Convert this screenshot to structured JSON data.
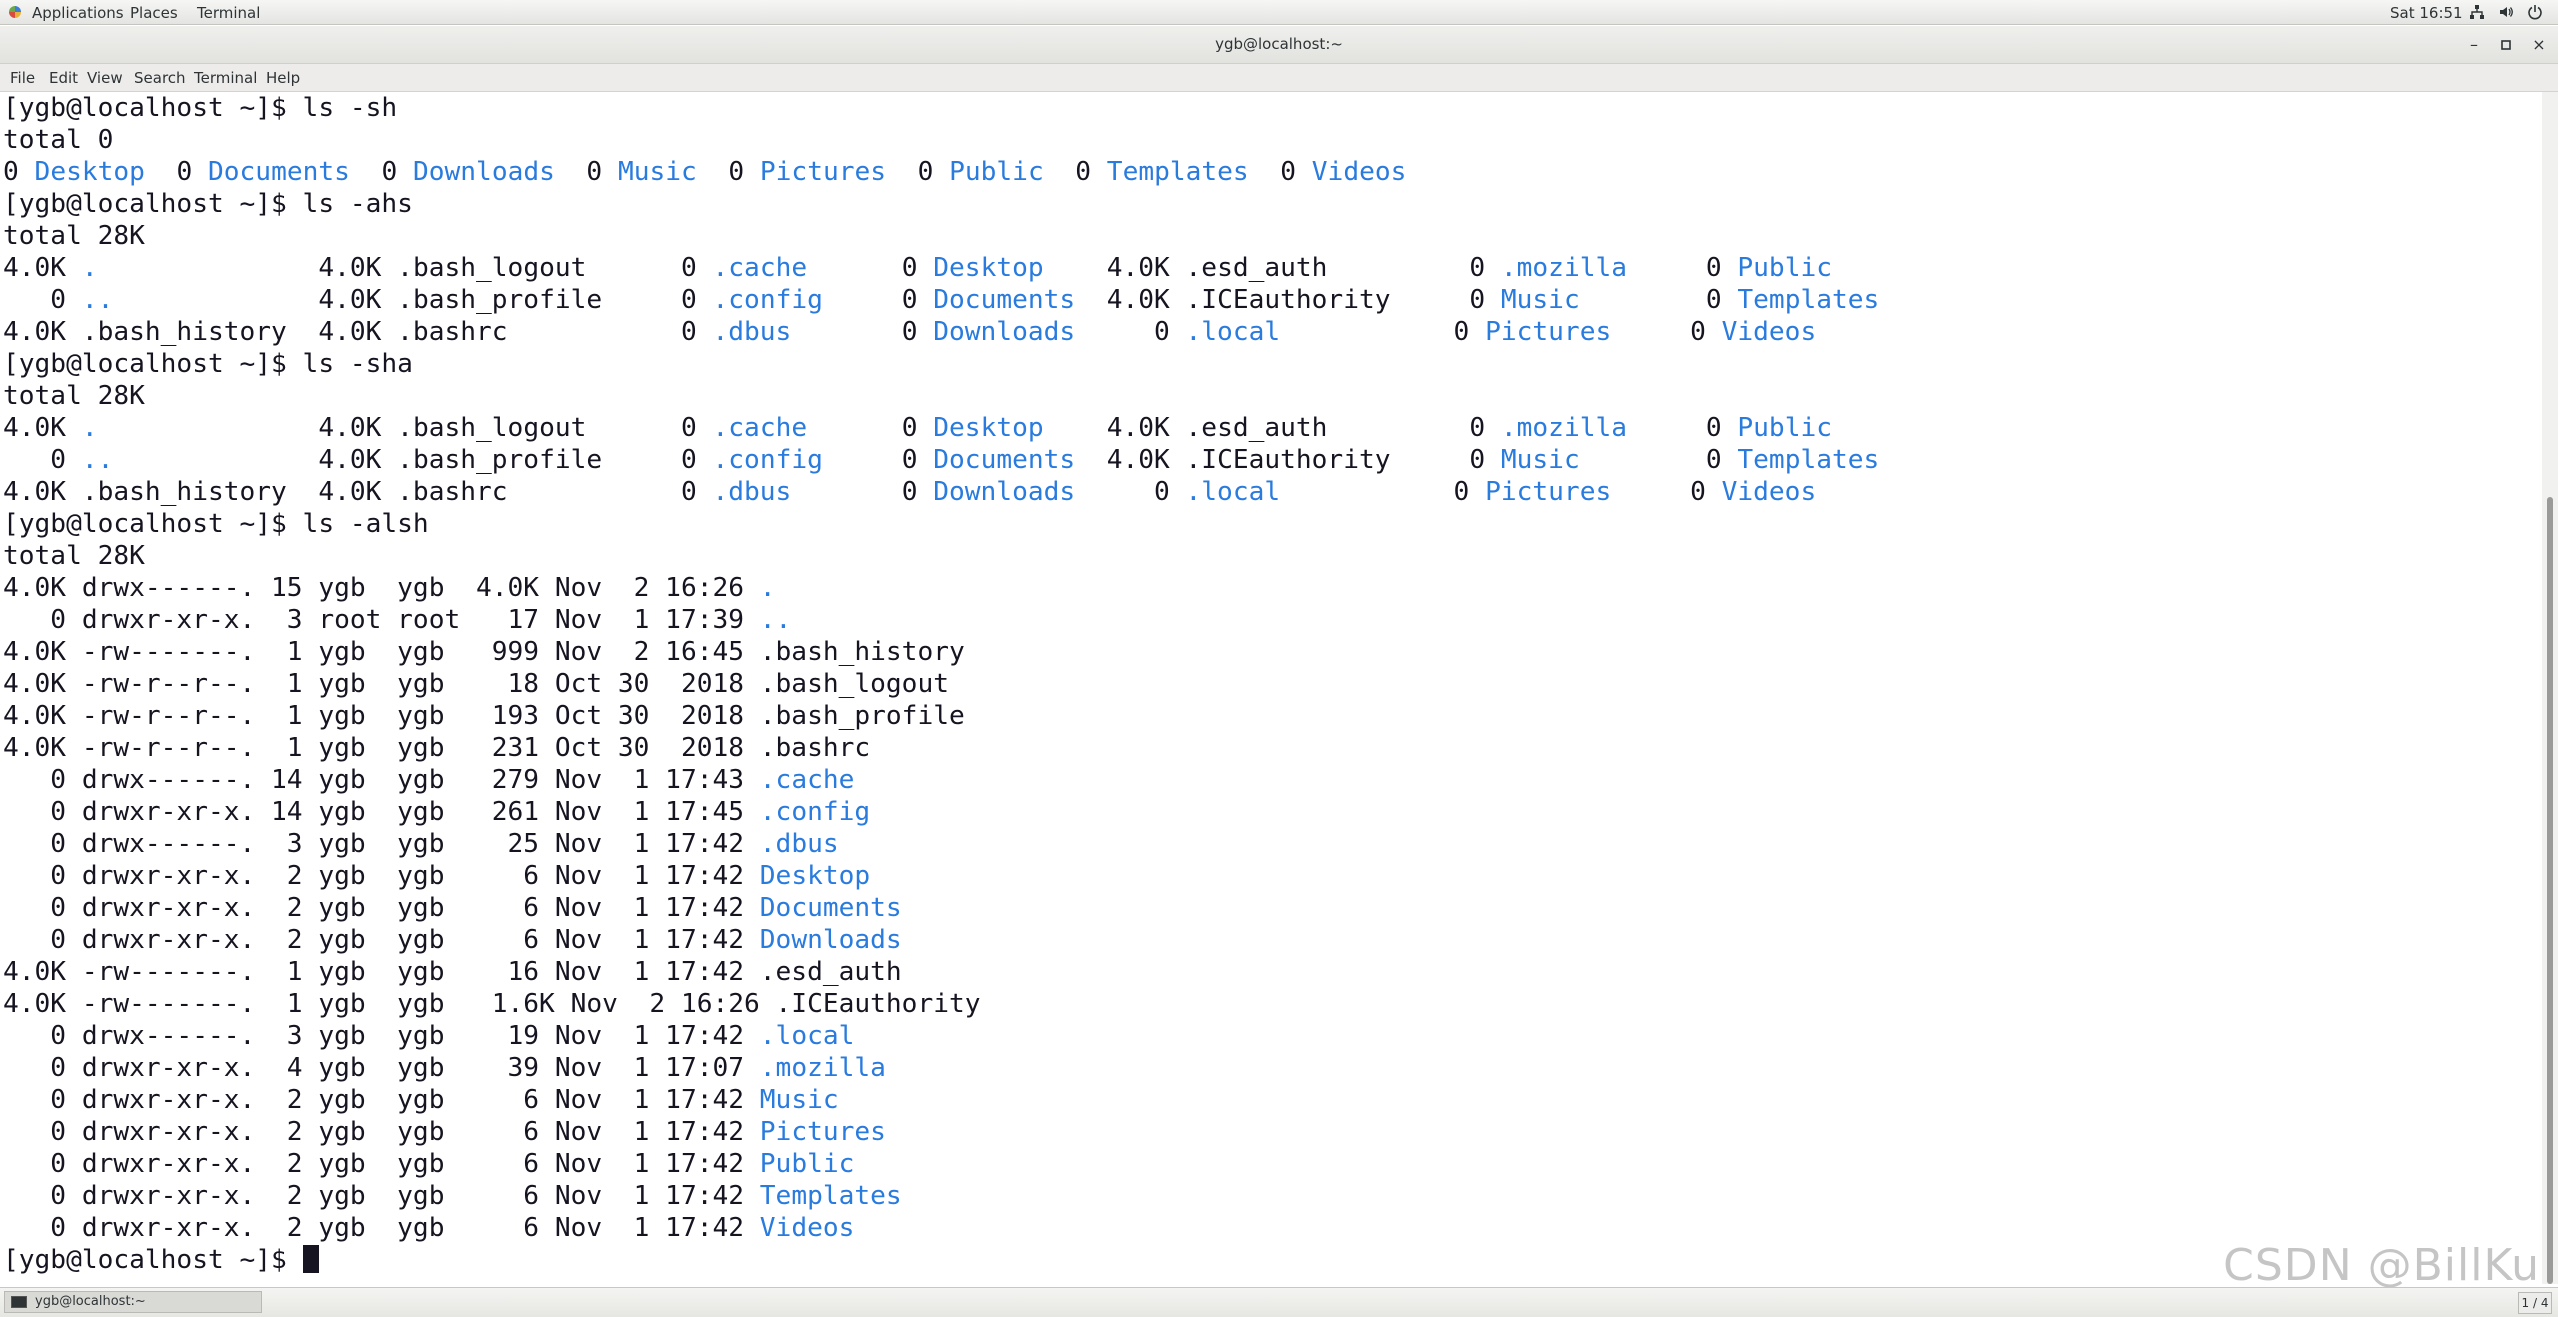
{
  "topbar": {
    "applications": "Applications",
    "places": "Places",
    "terminal": "Terminal",
    "clock": "Sat 16:51",
    "icons": [
      "network-icon",
      "volume-icon",
      "power-icon"
    ]
  },
  "window": {
    "title": "ygb@localhost:~",
    "controls": {
      "minimize": "–",
      "maximize": "◽",
      "close": "×"
    }
  },
  "menubar": [
    "File",
    "Edit",
    "View",
    "Search",
    "Terminal",
    "Help"
  ],
  "terminal": {
    "text_color": "#171421",
    "dir_color": "#2a7bde",
    "lines": [
      [
        {
          "t": "[ygb@localhost ~]$ ls -sh"
        }
      ],
      [
        {
          "t": "total 0"
        }
      ],
      [
        {
          "t": "0 "
        },
        {
          "t": "Desktop",
          "c": "dir"
        },
        {
          "t": "  0 "
        },
        {
          "t": "Documents",
          "c": "dir"
        },
        {
          "t": "  0 "
        },
        {
          "t": "Downloads",
          "c": "dir"
        },
        {
          "t": "  0 "
        },
        {
          "t": "Music",
          "c": "dir"
        },
        {
          "t": "  0 "
        },
        {
          "t": "Pictures",
          "c": "dir"
        },
        {
          "t": "  0 "
        },
        {
          "t": "Public",
          "c": "dir"
        },
        {
          "t": "  0 "
        },
        {
          "t": "Templates",
          "c": "dir"
        },
        {
          "t": "  0 "
        },
        {
          "t": "Videos",
          "c": "dir"
        }
      ],
      [
        {
          "t": "[ygb@localhost ~]$ ls -ahs"
        }
      ],
      [
        {
          "t": "total 28K"
        }
      ],
      [
        {
          "t": "4.0K "
        },
        {
          "t": ".",
          "c": "dir"
        },
        {
          "t": "              4.0K .bash_logout      0 "
        },
        {
          "t": ".cache",
          "c": "dir"
        },
        {
          "t": "      0 "
        },
        {
          "t": "Desktop",
          "c": "dir"
        },
        {
          "t": "    4.0K .esd_auth         0 "
        },
        {
          "t": ".mozilla",
          "c": "dir"
        },
        {
          "t": "     0 "
        },
        {
          "t": "Public",
          "c": "dir"
        }
      ],
      [
        {
          "t": "   0 "
        },
        {
          "t": "..",
          "c": "dir"
        },
        {
          "t": "             4.0K .bash_profile     0 "
        },
        {
          "t": ".config",
          "c": "dir"
        },
        {
          "t": "     0 "
        },
        {
          "t": "Documents",
          "c": "dir"
        },
        {
          "t": "  4.0K .ICEauthority     0 "
        },
        {
          "t": "Music",
          "c": "dir"
        },
        {
          "t": "        0 "
        },
        {
          "t": "Templates",
          "c": "dir"
        }
      ],
      [
        {
          "t": "4.0K .bash_history  4.0K .bashrc           0 "
        },
        {
          "t": ".dbus",
          "c": "dir"
        },
        {
          "t": "       0 "
        },
        {
          "t": "Downloads",
          "c": "dir"
        },
        {
          "t": "     0 "
        },
        {
          "t": ".local",
          "c": "dir"
        },
        {
          "t": "           0 "
        },
        {
          "t": "Pictures",
          "c": "dir"
        },
        {
          "t": "     0 "
        },
        {
          "t": "Videos",
          "c": "dir"
        }
      ],
      [
        {
          "t": "[ygb@localhost ~]$ ls -sha"
        }
      ],
      [
        {
          "t": "total 28K"
        }
      ],
      [
        {
          "t": "4.0K "
        },
        {
          "t": ".",
          "c": "dir"
        },
        {
          "t": "              4.0K .bash_logout      0 "
        },
        {
          "t": ".cache",
          "c": "dir"
        },
        {
          "t": "      0 "
        },
        {
          "t": "Desktop",
          "c": "dir"
        },
        {
          "t": "    4.0K .esd_auth         0 "
        },
        {
          "t": ".mozilla",
          "c": "dir"
        },
        {
          "t": "     0 "
        },
        {
          "t": "Public",
          "c": "dir"
        }
      ],
      [
        {
          "t": "   0 "
        },
        {
          "t": "..",
          "c": "dir"
        },
        {
          "t": "             4.0K .bash_profile     0 "
        },
        {
          "t": ".config",
          "c": "dir"
        },
        {
          "t": "     0 "
        },
        {
          "t": "Documents",
          "c": "dir"
        },
        {
          "t": "  4.0K .ICEauthority     0 "
        },
        {
          "t": "Music",
          "c": "dir"
        },
        {
          "t": "        0 "
        },
        {
          "t": "Templates",
          "c": "dir"
        }
      ],
      [
        {
          "t": "4.0K .bash_history  4.0K .bashrc           0 "
        },
        {
          "t": ".dbus",
          "c": "dir"
        },
        {
          "t": "       0 "
        },
        {
          "t": "Downloads",
          "c": "dir"
        },
        {
          "t": "     0 "
        },
        {
          "t": ".local",
          "c": "dir"
        },
        {
          "t": "           0 "
        },
        {
          "t": "Pictures",
          "c": "dir"
        },
        {
          "t": "     0 "
        },
        {
          "t": "Videos",
          "c": "dir"
        }
      ],
      [
        {
          "t": "[ygb@localhost ~]$ ls -alsh"
        }
      ],
      [
        {
          "t": "total 28K"
        }
      ],
      [
        {
          "t": "4.0K drwx------. 15 ygb  ygb  4.0K Nov  2 16:26 "
        },
        {
          "t": ".",
          "c": "dir"
        }
      ],
      [
        {
          "t": "   0 drwxr-xr-x.  3 root root   17 Nov  1 17:39 "
        },
        {
          "t": "..",
          "c": "dir"
        }
      ],
      [
        {
          "t": "4.0K -rw-------.  1 ygb  ygb   999 Nov  2 16:45 .bash_history"
        }
      ],
      [
        {
          "t": "4.0K -rw-r--r--.  1 ygb  ygb    18 Oct 30  2018 .bash_logout"
        }
      ],
      [
        {
          "t": "4.0K -rw-r--r--.  1 ygb  ygb   193 Oct 30  2018 .bash_profile"
        }
      ],
      [
        {
          "t": "4.0K -rw-r--r--.  1 ygb  ygb   231 Oct 30  2018 .bashrc"
        }
      ],
      [
        {
          "t": "   0 drwx------. 14 ygb  ygb   279 Nov  1 17:43 "
        },
        {
          "t": ".cache",
          "c": "dir"
        }
      ],
      [
        {
          "t": "   0 drwxr-xr-x. 14 ygb  ygb   261 Nov  1 17:45 "
        },
        {
          "t": ".config",
          "c": "dir"
        }
      ],
      [
        {
          "t": "   0 drwx------.  3 ygb  ygb    25 Nov  1 17:42 "
        },
        {
          "t": ".dbus",
          "c": "dir"
        }
      ],
      [
        {
          "t": "   0 drwxr-xr-x.  2 ygb  ygb     6 Nov  1 17:42 "
        },
        {
          "t": "Desktop",
          "c": "dir"
        }
      ],
      [
        {
          "t": "   0 drwxr-xr-x.  2 ygb  ygb     6 Nov  1 17:42 "
        },
        {
          "t": "Documents",
          "c": "dir"
        }
      ],
      [
        {
          "t": "   0 drwxr-xr-x.  2 ygb  ygb     6 Nov  1 17:42 "
        },
        {
          "t": "Downloads",
          "c": "dir"
        }
      ],
      [
        {
          "t": "4.0K -rw-------.  1 ygb  ygb    16 Nov  1 17:42 .esd_auth"
        }
      ],
      [
        {
          "t": "4.0K -rw-------.  1 ygb  ygb   1.6K Nov  2 16:26 .ICEauthority"
        }
      ],
      [
        {
          "t": "   0 drwx------.  3 ygb  ygb    19 Nov  1 17:42 "
        },
        {
          "t": ".local",
          "c": "dir"
        }
      ],
      [
        {
          "t": "   0 drwxr-xr-x.  4 ygb  ygb    39 Nov  1 17:07 "
        },
        {
          "t": ".mozilla",
          "c": "dir"
        }
      ],
      [
        {
          "t": "   0 drwxr-xr-x.  2 ygb  ygb     6 Nov  1 17:42 "
        },
        {
          "t": "Music",
          "c": "dir"
        }
      ],
      [
        {
          "t": "   0 drwxr-xr-x.  2 ygb  ygb     6 Nov  1 17:42 "
        },
        {
          "t": "Pictures",
          "c": "dir"
        }
      ],
      [
        {
          "t": "   0 drwxr-xr-x.  2 ygb  ygb     6 Nov  1 17:42 "
        },
        {
          "t": "Public",
          "c": "dir"
        }
      ],
      [
        {
          "t": "   0 drwxr-xr-x.  2 ygb  ygb     6 Nov  1 17:42 "
        },
        {
          "t": "Templates",
          "c": "dir"
        }
      ],
      [
        {
          "t": "   0 drwxr-xr-x.  2 ygb  ygb     6 Nov  1 17:42 "
        },
        {
          "t": "Videos",
          "c": "dir"
        }
      ],
      [
        {
          "t": "[ygb@localhost ~]$ "
        },
        {
          "c": "cursor"
        }
      ]
    ]
  },
  "scrollbar": {
    "visible_fraction": 0.66,
    "scroll_position": 1.0
  },
  "watermark": "CSDN @BillKu",
  "taskbar": {
    "window_label": "ygb@localhost:~",
    "workspace": "1 / 4"
  }
}
